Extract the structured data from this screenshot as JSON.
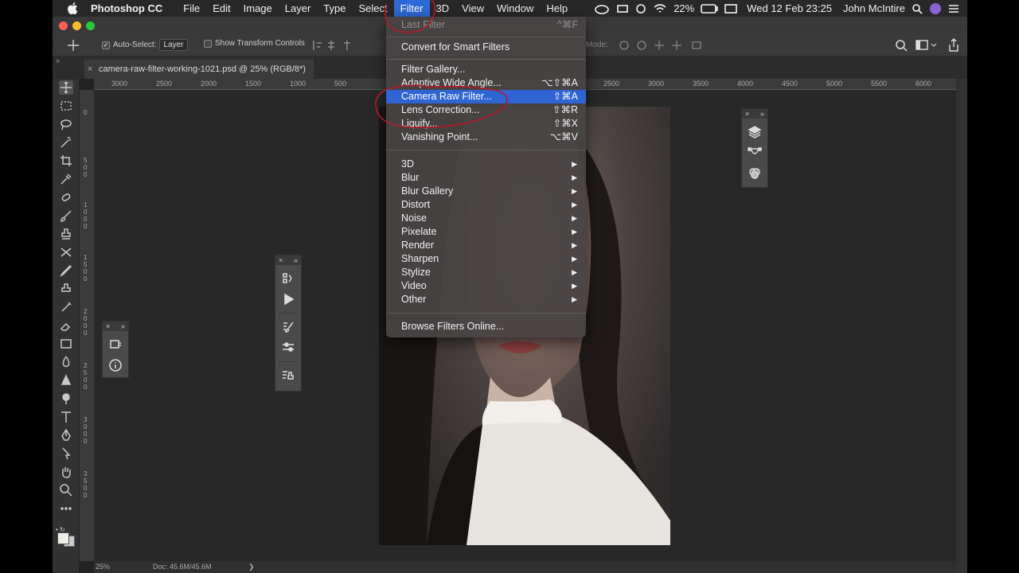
{
  "menubar": {
    "app_name": "Photoshop CC",
    "menus": [
      "File",
      "Edit",
      "Image",
      "Layer",
      "Type",
      "Select",
      "Filter",
      "3D",
      "View",
      "Window",
      "Help"
    ],
    "active_menu": "Filter",
    "battery": "22%",
    "datetime": "Wed 12 Feb  23:25",
    "user": "John McIntire"
  },
  "options_bar": {
    "auto_select_label": "Auto-Select:",
    "auto_select_value": "Layer",
    "show_transform_label": "Show Transform Controls",
    "mode_label": "Mode:"
  },
  "document": {
    "tab_title": "camera-raw-filter-working-1021.psd @ 25% (RGB/8*)",
    "close_glyph": "×"
  },
  "rulers": {
    "top_ticks": [
      "3000",
      "2500",
      "2000",
      "1500",
      "1000",
      "500",
      "2500",
      "3000",
      "3500",
      "4000",
      "4500",
      "5000",
      "5500",
      "6000"
    ],
    "left_ticks": [
      "0",
      "5 0 0",
      "1 0 0 0",
      "1 5 0 0",
      "2 0 0 0",
      "2 5 0 0",
      "3 0 0 0",
      "3 5 0 0"
    ]
  },
  "status_bar": {
    "zoom": "25%",
    "doc": "Doc: 45.6M/45.6M",
    "arrow": "❯"
  },
  "filter_menu": {
    "items": [
      {
        "label": "Last Filter",
        "shortcut": "^⌘F",
        "disabled": true
      },
      {
        "label": "Convert for Smart Filters"
      },
      {
        "label": "Filter Gallery..."
      },
      {
        "label": "Adaptive Wide Angle...",
        "shortcut": "⌥⇧⌘A"
      },
      {
        "label": "Camera Raw Filter...",
        "shortcut": "⇧⌘A",
        "highlighted": true
      },
      {
        "label": "Lens Correction...",
        "shortcut": "⇧⌘R"
      },
      {
        "label": "Liquify...",
        "shortcut": "⇧⌘X"
      },
      {
        "label": "Vanishing Point...",
        "shortcut": "⌥⌘V"
      },
      {
        "label": "3D",
        "submenu": true
      },
      {
        "label": "Blur",
        "submenu": true
      },
      {
        "label": "Blur Gallery",
        "submenu": true
      },
      {
        "label": "Distort",
        "submenu": true
      },
      {
        "label": "Noise",
        "submenu": true
      },
      {
        "label": "Pixelate",
        "submenu": true
      },
      {
        "label": "Render",
        "submenu": true
      },
      {
        "label": "Sharpen",
        "submenu": true
      },
      {
        "label": "Stylize",
        "submenu": true
      },
      {
        "label": "Video",
        "submenu": true
      },
      {
        "label": "Other",
        "submenu": true
      },
      {
        "label": "Browse Filters Online..."
      }
    ],
    "submenu_arrow": "▶"
  },
  "panels": {
    "close_glyph": "×",
    "collapse_glyph": "»"
  },
  "colors": {
    "menu_highlight": "#2f64d4",
    "annotation_red": "#b31a2a",
    "traffic_red": "#fc5f57",
    "traffic_yellow": "#fdbc2e",
    "traffic_green": "#28c840"
  }
}
